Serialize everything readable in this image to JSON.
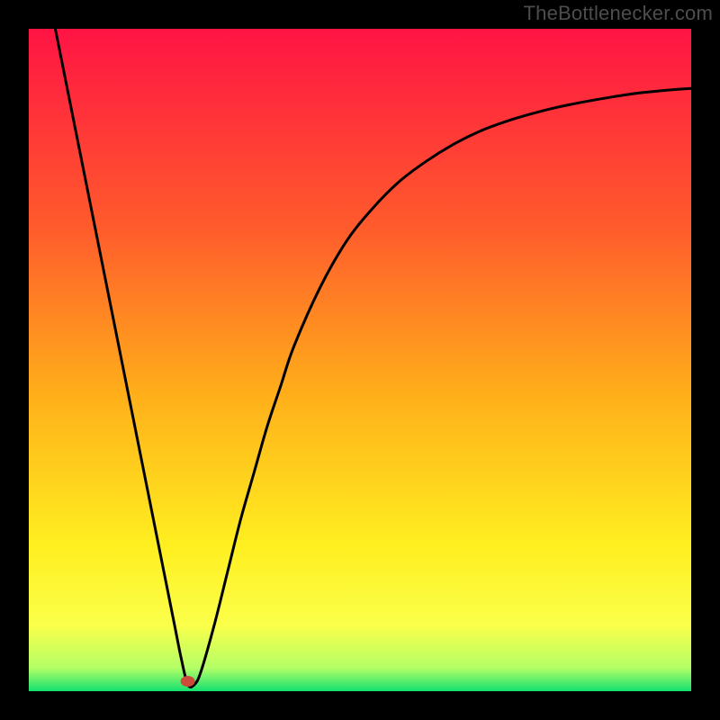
{
  "watermark": "TheBottlenecker.com",
  "chart_data": {
    "type": "line",
    "title": "",
    "xlabel": "",
    "ylabel": "",
    "xlim": [
      0,
      100
    ],
    "ylim": [
      0,
      100
    ],
    "grid": false,
    "legend": false,
    "background_gradient": {
      "stops": [
        {
          "offset": 0.0,
          "color": "#ff1444"
        },
        {
          "offset": 0.3,
          "color": "#ff5b2c"
        },
        {
          "offset": 0.55,
          "color": "#ffae1a"
        },
        {
          "offset": 0.78,
          "color": "#ffef20"
        },
        {
          "offset": 0.9,
          "color": "#fbff4a"
        },
        {
          "offset": 0.965,
          "color": "#b3ff66"
        },
        {
          "offset": 1.0,
          "color": "#13e070"
        }
      ]
    },
    "marker": {
      "x": 24,
      "y": 1.5,
      "color": "#cc4b3a"
    },
    "series": [
      {
        "name": "curve",
        "color": "#000000",
        "x": [
          4,
          6,
          8,
          10,
          12,
          14,
          16,
          18,
          20,
          22,
          23,
          24,
          25,
          26,
          28,
          30,
          32,
          34,
          36,
          38,
          40,
          44,
          48,
          52,
          56,
          60,
          64,
          68,
          72,
          76,
          80,
          84,
          88,
          92,
          96,
          100
        ],
        "y": [
          100,
          90,
          80,
          70,
          60,
          50,
          40,
          30,
          20,
          10,
          5,
          1,
          1,
          3,
          10,
          18,
          26,
          33,
          40,
          46,
          52,
          61,
          68,
          73,
          77,
          80,
          82.5,
          84.5,
          86,
          87.2,
          88.2,
          89,
          89.7,
          90.3,
          90.7,
          91
        ]
      }
    ]
  }
}
